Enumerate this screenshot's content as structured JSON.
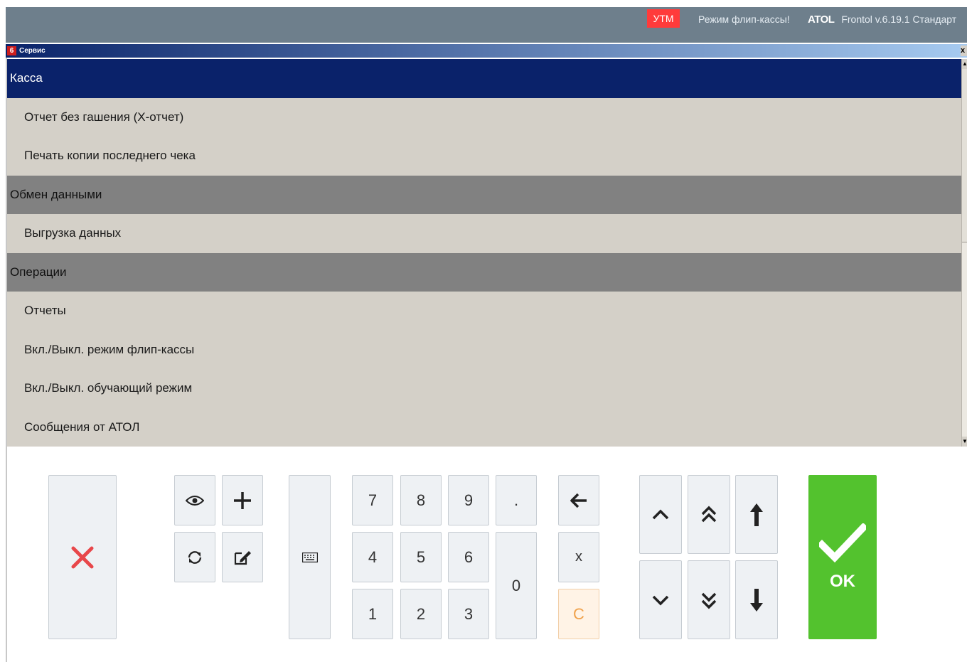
{
  "topbar": {
    "utm_label": "УТМ",
    "mode_text": "Режим флип-кассы!",
    "brand_logo": "ATOL",
    "version": "Frontol v.6.19.1 Стандарт"
  },
  "window": {
    "number": "6",
    "title": "Сервис",
    "close_symbol": "x"
  },
  "menu": [
    {
      "type": "category",
      "label": "Касса",
      "selected": true
    },
    {
      "type": "item",
      "label": "Отчет без гашения (X-отчет)"
    },
    {
      "type": "item",
      "label": "Печать копии последнего чека"
    },
    {
      "type": "category",
      "label": "Обмен данными"
    },
    {
      "type": "item",
      "label": "Выгрузка данных"
    },
    {
      "type": "category",
      "label": "Операции"
    },
    {
      "type": "item",
      "label": "Отчеты"
    },
    {
      "type": "item",
      "label": "Вкл./Выкл. режим флип-кассы"
    },
    {
      "type": "item",
      "label": "Вкл./Выкл. обучающий режим"
    },
    {
      "type": "item",
      "label": "Сообщения от АТОЛ"
    }
  ],
  "keypad": {
    "digits": {
      "seven": "7",
      "eight": "8",
      "nine": "9",
      "four": "4",
      "five": "5",
      "six": "6",
      "one": "1",
      "two": "2",
      "three": "3",
      "zero": "0"
    },
    "dot": ".",
    "multiply": "x",
    "clear": "C",
    "ok": "OK"
  },
  "colors": {
    "topbar": "#6e7f8c",
    "utm_badge": "#ff3b3b",
    "selected_category": "#0a226a",
    "category": "#818181",
    "item": "#d4d0c8",
    "ok_button": "#53c22e",
    "cancel_icon": "#e8474a",
    "clear_key": "#f0a14a"
  },
  "icons": {
    "cancel": "close-x-icon",
    "view": "eye-icon",
    "add": "plus-icon",
    "refresh": "refresh-icon",
    "edit": "edit-icon",
    "keyboard": "keyboard-icon",
    "backspace": "arrow-left-icon",
    "up": "chevron-up-icon",
    "page_up": "double-chevron-up-icon",
    "top": "arrow-up-icon",
    "down": "chevron-down-icon",
    "page_down": "double-chevron-down-icon",
    "bottom": "arrow-down-icon",
    "ok": "checkmark-icon"
  }
}
